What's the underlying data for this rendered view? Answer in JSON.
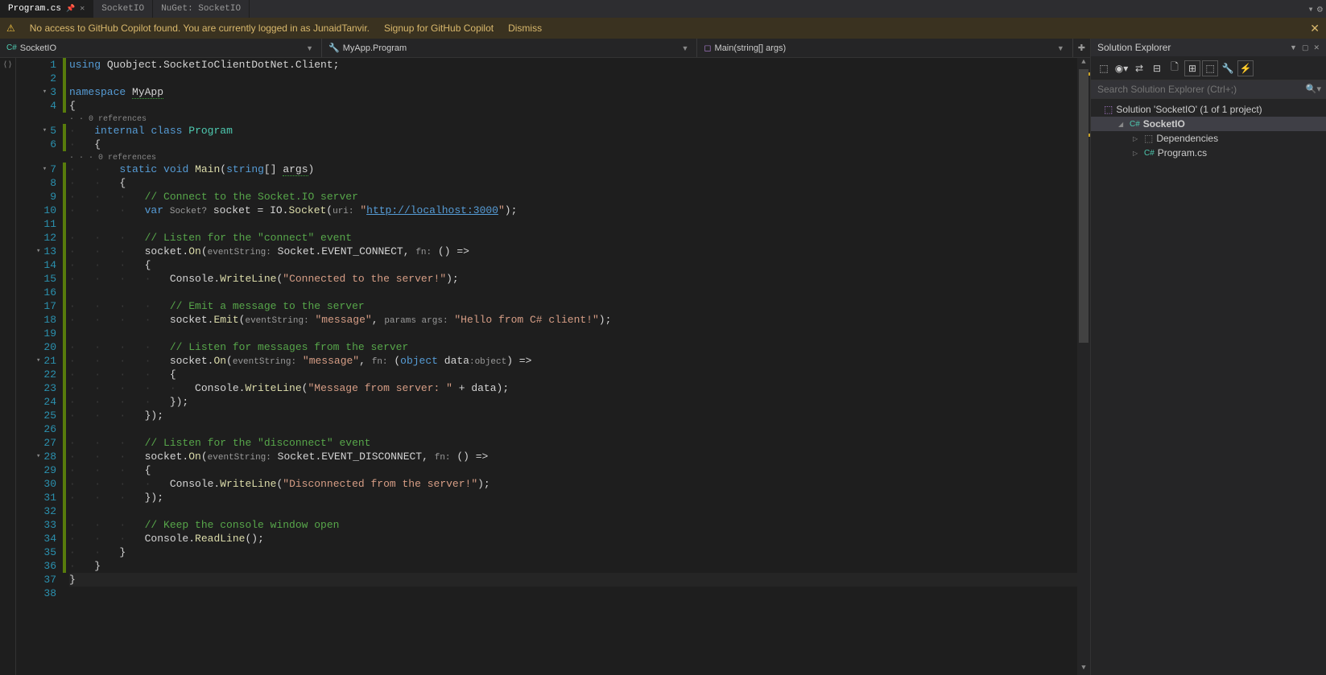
{
  "tabs": [
    {
      "label": "Program.cs",
      "active": true,
      "pinned": true
    },
    {
      "label": "SocketIO",
      "active": false
    },
    {
      "label": "NuGet: SocketIO",
      "active": false
    }
  ],
  "copilot": {
    "message": "No access to GitHub Copilot found. You are currently logged in as JunaidTanvir.",
    "signup": "Signup for GitHub Copilot",
    "dismiss": "Dismiss"
  },
  "navbar": {
    "project": "SocketIO",
    "class": "MyApp.Program",
    "member": "Main(string[] args)"
  },
  "references": {
    "program": "0 references",
    "main": "0 references"
  },
  "code": {
    "l1_using": "using",
    "l1_ns": " Quobject.SocketIoClientDotNet.Client;",
    "l3_ns": "namespace",
    "l3_name": "MyApp",
    "l5_internal": "internal",
    "l5_class": "class",
    "l5_name": "Program",
    "l7_static": "static",
    "l7_void": "void",
    "l7_main": "Main",
    "l7_string": "string",
    "l7_args": "args",
    "l9_cmt": "// Connect to the Socket.IO server",
    "l10_var": "var",
    "l10_type": "Socket?",
    "l10_eq": " socket = IO.",
    "l10_method": "Socket",
    "l10_param": "uri:",
    "l10_url": "http://localhost:3000",
    "l12_cmt": "// Listen for the \"connect\" event",
    "l13_on": "On",
    "l13_param1": "eventString:",
    "l13_ev": " Socket.EVENT_CONNECT, ",
    "l13_fn": "fn:",
    "l15_wl": "WriteLine",
    "l15_str": "\"Connected to the server!\"",
    "l17_cmt": "// Emit a message to the server",
    "l18_emit": "Emit",
    "l18_p1": "eventString:",
    "l18_msg": "\"message\"",
    "l18_p2": "params args:",
    "l18_str": "\"Hello from C# client!\"",
    "l20_cmt": "// Listen for messages from the server",
    "l21_p1": "eventString:",
    "l21_msg": "\"message\"",
    "l21_fn": "fn:",
    "l21_obj": "object",
    "l21_data": "data",
    "l21_objt": ":object",
    "l23_str": "\"Message from server: \"",
    "l27_cmt": "// Listen for the \"disconnect\" event",
    "l28_ev": " Socket.EVENT_DISCONNECT, ",
    "l30_str": "\"Disconnected from the server!\"",
    "l33_cmt": "// Keep the console window open",
    "l34_rl": "ReadLine"
  },
  "explorer": {
    "title": "Solution Explorer",
    "search_placeholder": "Search Solution Explorer (Ctrl+;)",
    "solution": "Solution 'SocketIO' (1 of 1 project)",
    "project": "SocketIO",
    "deps": "Dependencies",
    "file": "Program.cs"
  }
}
